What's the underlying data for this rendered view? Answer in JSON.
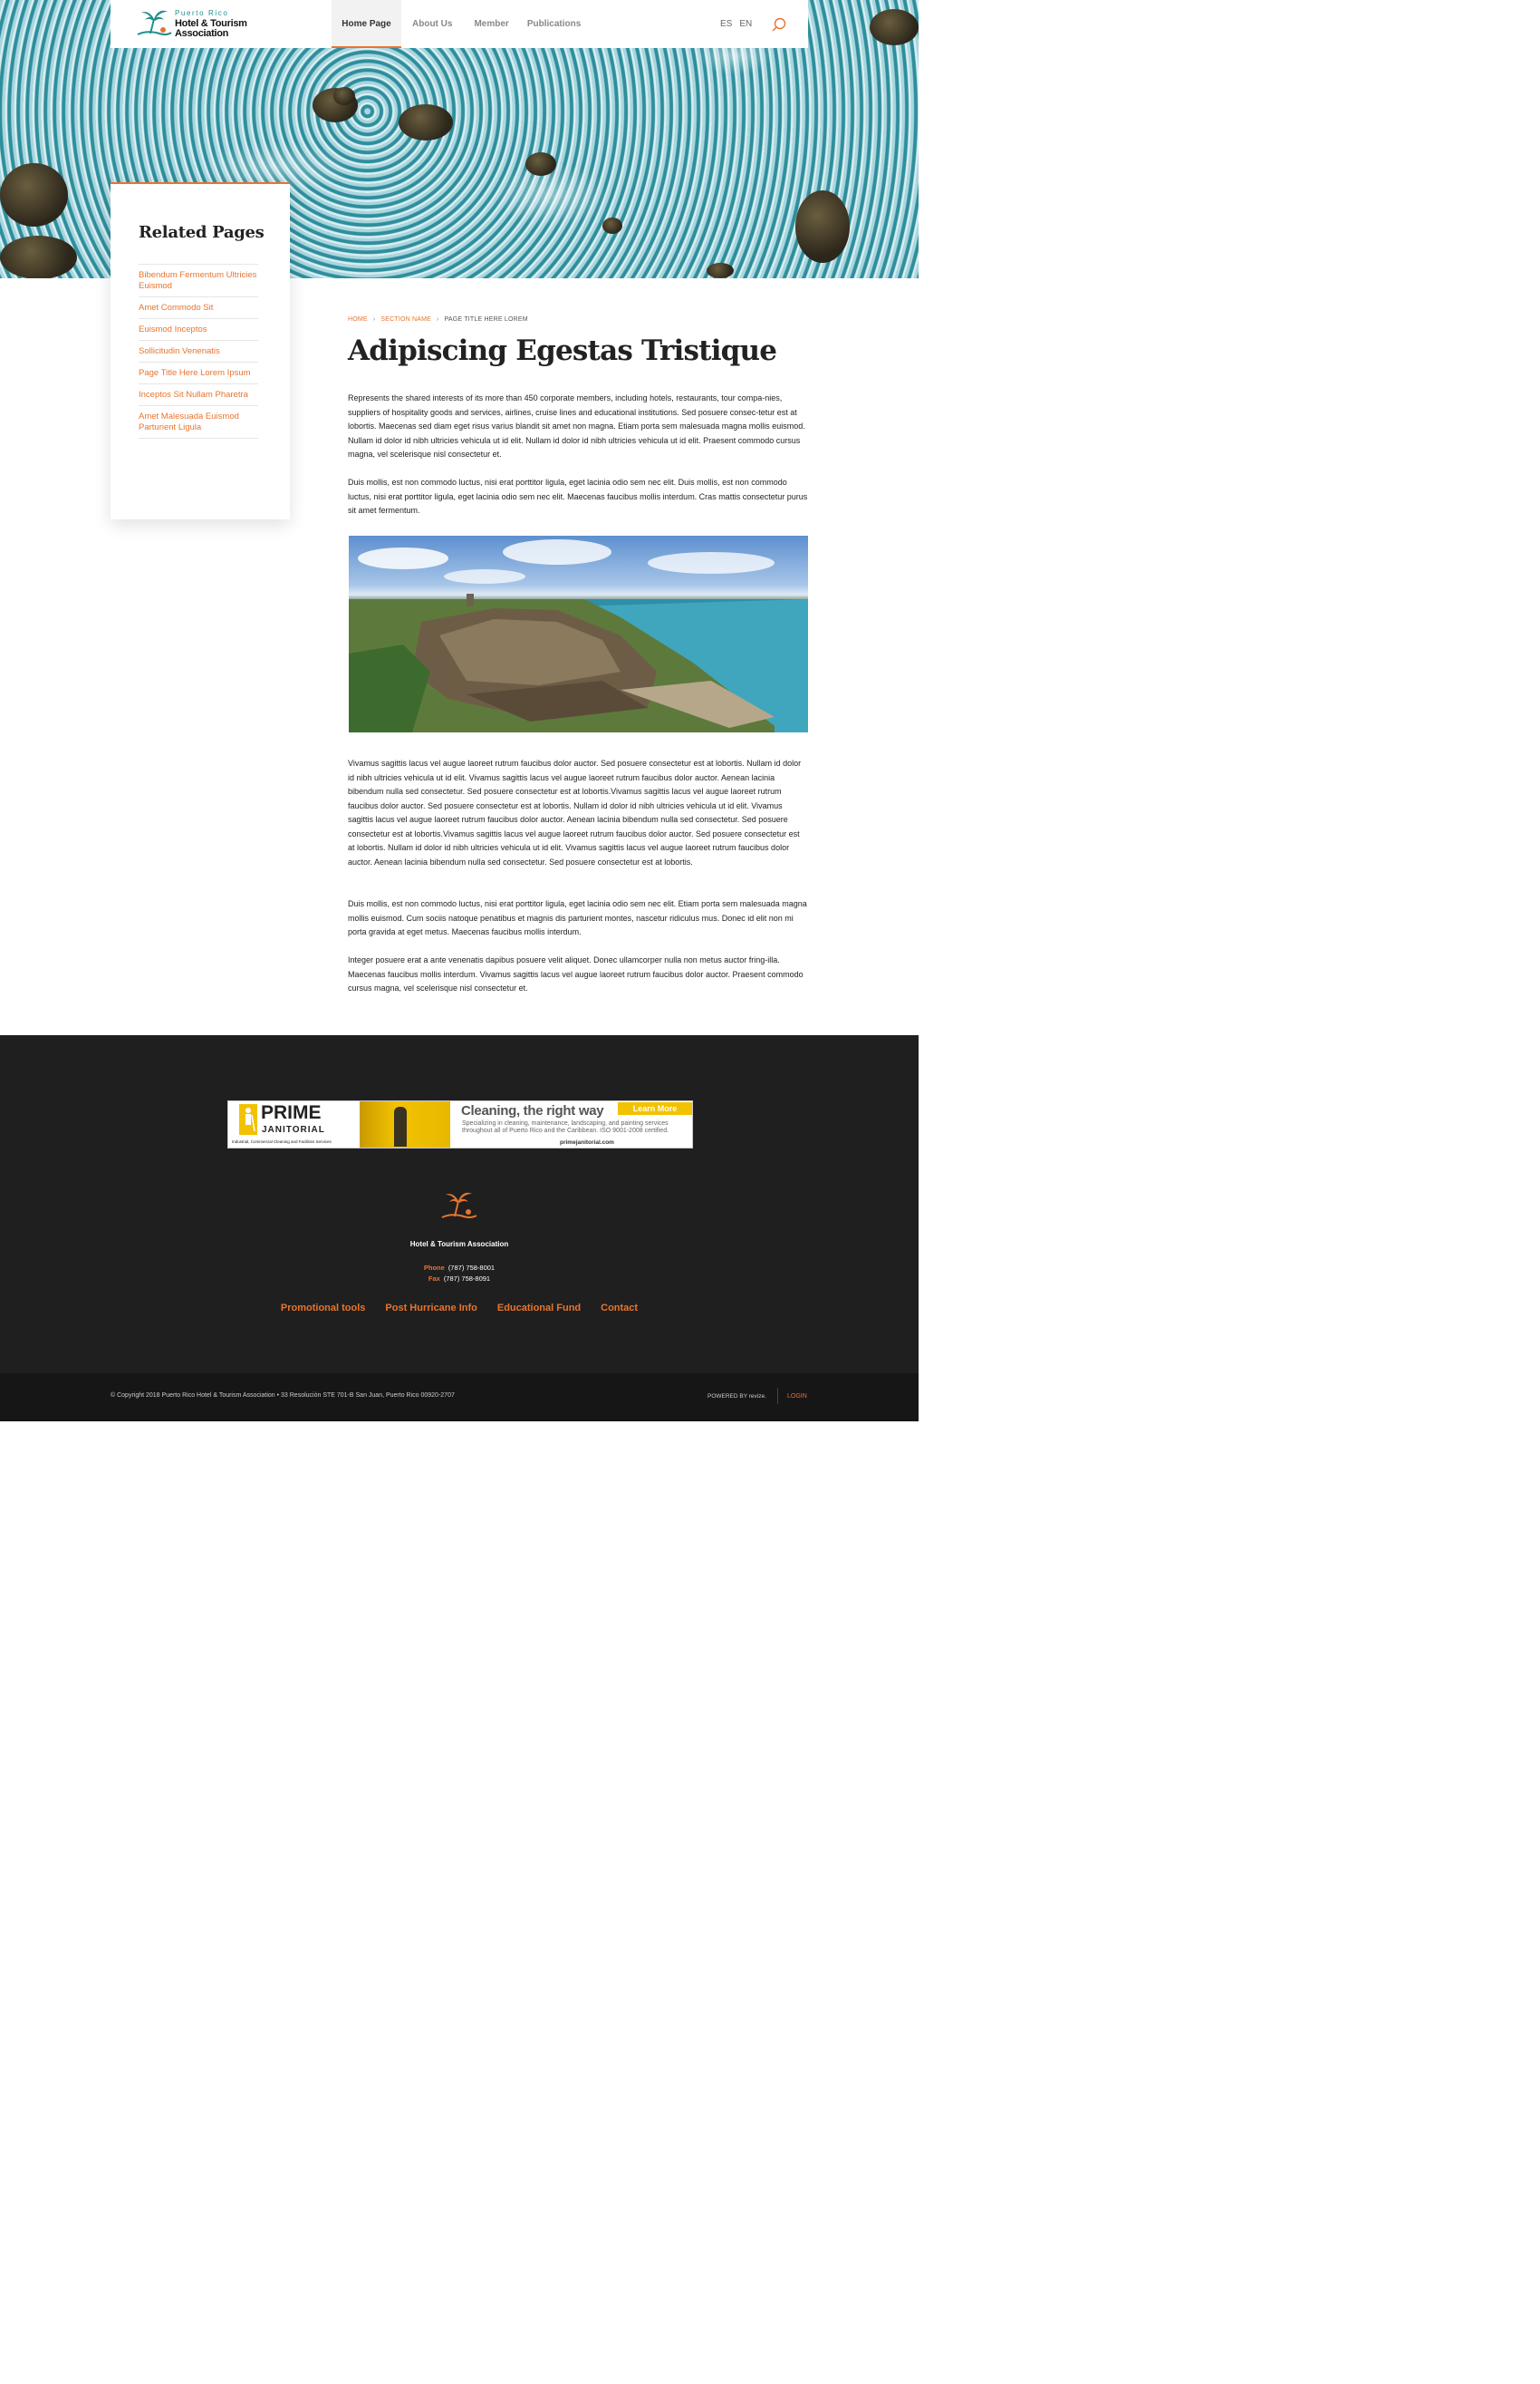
{
  "header": {
    "logo": {
      "top": "Puerto Rico",
      "line1": "Hotel & Tourism",
      "line2": "Association"
    },
    "nav": [
      "Home Page",
      "About Us",
      "Member",
      "Publications"
    ],
    "lang": [
      "ES",
      "EN"
    ],
    "search_icon": "search-icon"
  },
  "sidebar": {
    "title": "Related Pages",
    "items": [
      "Bibendum Fermentum Ultricies Euismod",
      "Amet Commodo Sit",
      "Euismod Inceptos",
      "Sollicitudin Venenatis",
      "Page Title Here Lorem Ipsum",
      "Inceptos Sit Nullam Pharetra",
      "Amet Malesuada Euismod Parturient Ligula"
    ]
  },
  "main": {
    "breadcrumb": {
      "home": "HOME",
      "section": "SECTION NAME",
      "current": "PAGE TITLE HERE LOREM",
      "sep": "›"
    },
    "title": "Adipiscing Egestas Tristique",
    "paragraphs": [
      "Represents the shared interests of its more than 450 corporate members, including hotels, restaurants, tour compa-nies, suppliers of hospitality goods and services, airlines, cruise lines and educational institutions. Sed posuere consec-tetur est at lobortis. Maecenas sed diam eget risus varius blandit sit amet non magna. Etiam porta sem malesuada magna mollis euismod. Nullam id dolor id nibh ultricies vehicula ut id elit. Nullam id dolor id nibh ultricies vehicula ut id elit. Praesent commodo cursus magna, vel scelerisque nisl consectetur et.",
      "Duis mollis, est non commodo luctus, nisi erat porttitor ligula, eget lacinia odio sem nec elit. Duis mollis, est non commodo luctus, nisi erat porttitor ligula, eget lacinia odio sem nec elit. Maecenas faucibus mollis interdum. Cras mattis consectetur purus sit amet fermentum.",
      "Vivamus sagittis lacus vel augue laoreet rutrum faucibus dolor auctor. Sed posuere consectetur est at lobortis. Nullam id dolor id nibh ultricies vehicula ut id elit. Vivamus sagittis lacus vel augue laoreet rutrum faucibus dolor auctor. Aenean lacinia bibendum nulla sed consectetur. Sed posuere consectetur est at lobortis.Vivamus sagittis lacus vel augue laoreet rutrum faucibus dolor auctor. Sed posuere consectetur est at lobortis. Nullam id dolor id nibh ultricies vehicula ut id elit. Vivamus sagittis lacus vel augue laoreet rutrum faucibus dolor auctor. Aenean lacinia bibendum nulla sed consectetur. Sed posuere consectetur est at lobortis.Vivamus sagittis lacus vel augue laoreet rutrum faucibus dolor auctor. Sed posuere consectetur est at lobortis. Nullam id dolor id nibh ultricies vehicula ut id elit. Vivamus sagittis lacus vel augue laoreet rutrum faucibus dolor auctor. Aenean lacinia bibendum nulla sed consectetur. Sed posuere consectetur est at lobortis.",
      "Duis mollis, est non commodo luctus, nisi erat porttitor ligula, eget lacinia odio sem nec elit. Etiam porta sem malesuada magna mollis euismod. Cum sociis natoque penatibus et magnis dis parturient montes, nascetur ridiculus mus. Donec id elit non mi porta gravida at eget metus. Maecenas faucibus mollis interdum.",
      "Integer posuere erat a ante venenatis dapibus posuere velit aliquet. Donec ullamcorper nulla non metus auctor fring-illa. Maecenas faucibus mollis interdum. Vivamus sagittis lacus vel augue laoreet rutrum faucibus dolor auctor. Praesent commodo cursus magna, vel scelerisque nisl consectetur et."
    ]
  },
  "banner": {
    "brand": "PRIME",
    "brand_sub": "JANITORIAL",
    "brand_tag": "Industrial, Commercial Cleaning and Facilities Services",
    "headline": "Cleaning, the right way",
    "cta": "Learn More",
    "body": "Specializing in cleaning, maintenance, landscaping, and painting services throughout all of Puerto Rico and the Caribbean. ISO 9001-2008 certified.",
    "url": "primejanitorial.com"
  },
  "footer": {
    "name": "Hotel & Tourism Association",
    "phone_label": "Phone",
    "phone": "(787) 758-8001",
    "fax_label": "Fax",
    "fax": "(787) 758-8091",
    "links": [
      "Promotional tools",
      "Post Hurricane Info",
      "Educational Fund",
      "Contact"
    ],
    "copyright": "© Copyright 2018 Puerto Rico Hotel & Tourism Association  •  33 Resolución STE 701-B San Juan, Puerto Rico 00920-2707",
    "powered": "POWERED BY revize.",
    "login": "LOGIN"
  },
  "colors": {
    "accent": "#e8742e",
    "dark": "#1f1f1f",
    "teal": "#1f8f8a"
  }
}
